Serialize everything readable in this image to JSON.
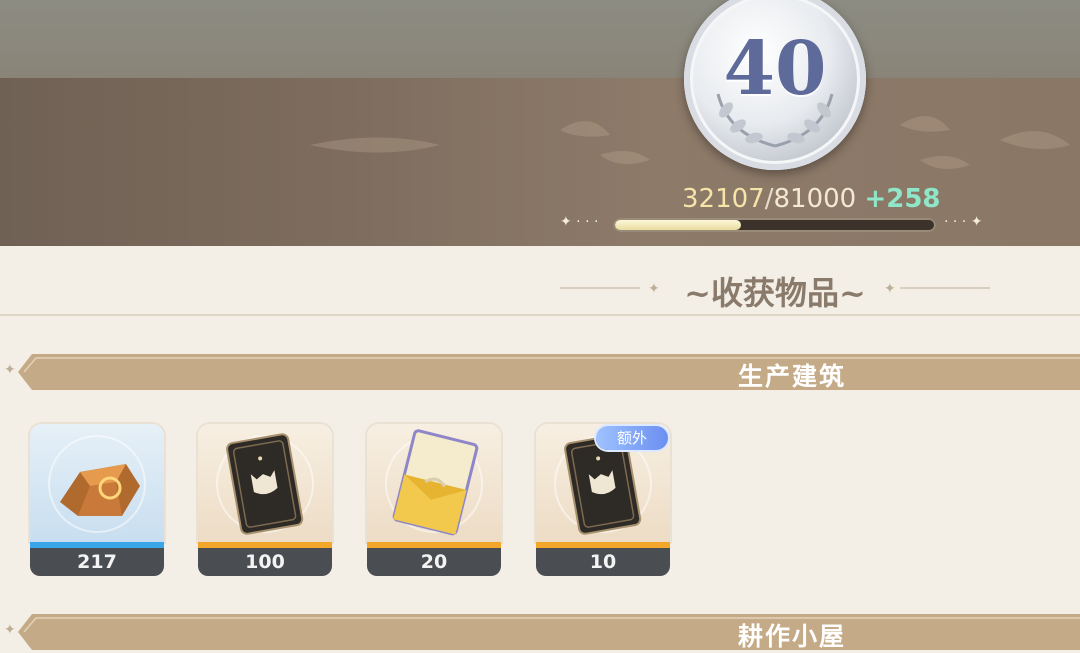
{
  "level": {
    "value": "40"
  },
  "exp": {
    "current": "32107",
    "separator": "/",
    "max": "81000",
    "gain": "+258",
    "progress": 0.396
  },
  "harvest": {
    "title": "~收获物品~"
  },
  "categories": [
    {
      "label": "生产建筑"
    },
    {
      "label": "耕作小屋"
    }
  ],
  "items": [
    {
      "icon": "amber-crystal-icon",
      "quantity": "217",
      "rarity_color": "#3aa6ea"
    },
    {
      "icon": "dark-card-icon",
      "quantity": "100",
      "rarity_color": "#f3a72a"
    },
    {
      "icon": "gold-envelope-icon",
      "quantity": "20",
      "rarity_color": "#f3a72a"
    },
    {
      "icon": "dark-card-icon",
      "quantity": "10",
      "rarity_color": "#f3a72a",
      "badge": "额外"
    }
  ]
}
